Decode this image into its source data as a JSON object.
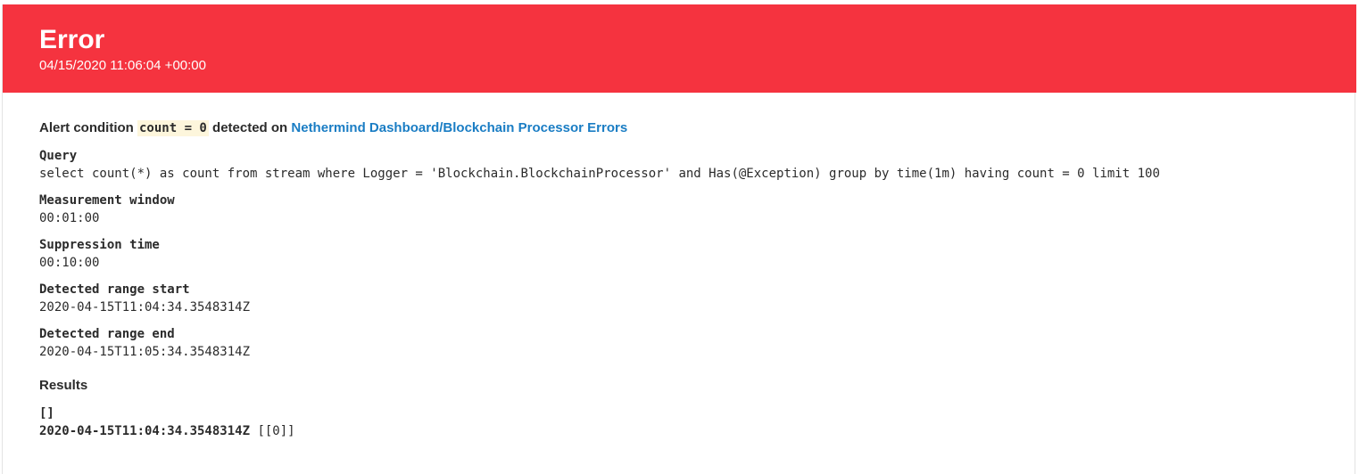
{
  "header": {
    "title": "Error",
    "timestamp": "04/15/2020 11:06:04 +00:00",
    "background_color": "#f5333f"
  },
  "alert": {
    "prefix": "Alert condition",
    "condition": "count = 0",
    "middle": "detected on",
    "signal_link": "Nethermind Dashboard/Blockchain Processor Errors",
    "link_color": "#1a7dc4"
  },
  "fields": {
    "query": {
      "label": "Query",
      "value": "select count(*) as count from stream where Logger = 'Blockchain.BlockchainProcessor' and Has(@Exception) group by time(1m) having count = 0 limit 100"
    },
    "measurement_window": {
      "label": "Measurement window",
      "value": "00:01:00"
    },
    "suppression_time": {
      "label": "Suppression time",
      "value": "00:10:00"
    },
    "range_start": {
      "label": "Detected range start",
      "value": "2020-04-15T11:04:34.3548314Z"
    },
    "range_end": {
      "label": "Detected range end",
      "value": "2020-04-15T11:05:34.3548314Z"
    }
  },
  "results": {
    "heading": "Results",
    "columns_line": "[]",
    "rows": [
      {
        "time": "2020-04-15T11:04:34.3548314Z",
        "values": "[[0]]"
      }
    ]
  }
}
